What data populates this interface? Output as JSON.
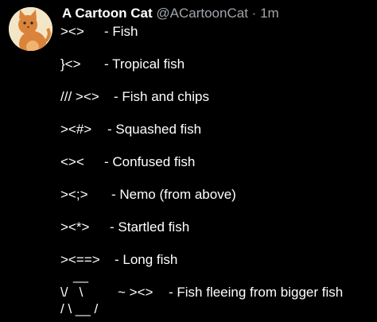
{
  "tweet": {
    "display_name": "A Cartoon Cat",
    "handle": "@ACartoonCat",
    "separator": "·",
    "time": "1m",
    "lines": [
      {
        "art": "><>",
        "desc": "- Fish"
      },
      {
        "art": "}<>",
        "desc": "- Tropical fish"
      },
      {
        "art": "/// ><>",
        "desc": "- Fish and chips"
      },
      {
        "art": "><#>",
        "desc": "- Squashed fish"
      },
      {
        "art": "<><",
        "desc": "- Confused fish"
      },
      {
        "art": "><;>",
        "desc": "- Nemo (from above)"
      },
      {
        "art": "><*>",
        "desc": "- Startled fish"
      },
      {
        "art": "><==>",
        "desc": "- Long fish"
      }
    ],
    "last": {
      "art_top": "__",
      "art_mid": "\\/   \\",
      "art_bottom": "/ \\ __ /",
      "middle": "~ ><>",
      "desc": "- Fish fleeing from bigger fish"
    }
  },
  "colors": {
    "background": "#000000",
    "text": "#ffffff",
    "secondary": "#a0a5aa",
    "avatar_bg": "#f3e6c7",
    "cat": "#d9843a"
  },
  "icons": {
    "avatar": "cartoon-cat-avatar-icon"
  }
}
